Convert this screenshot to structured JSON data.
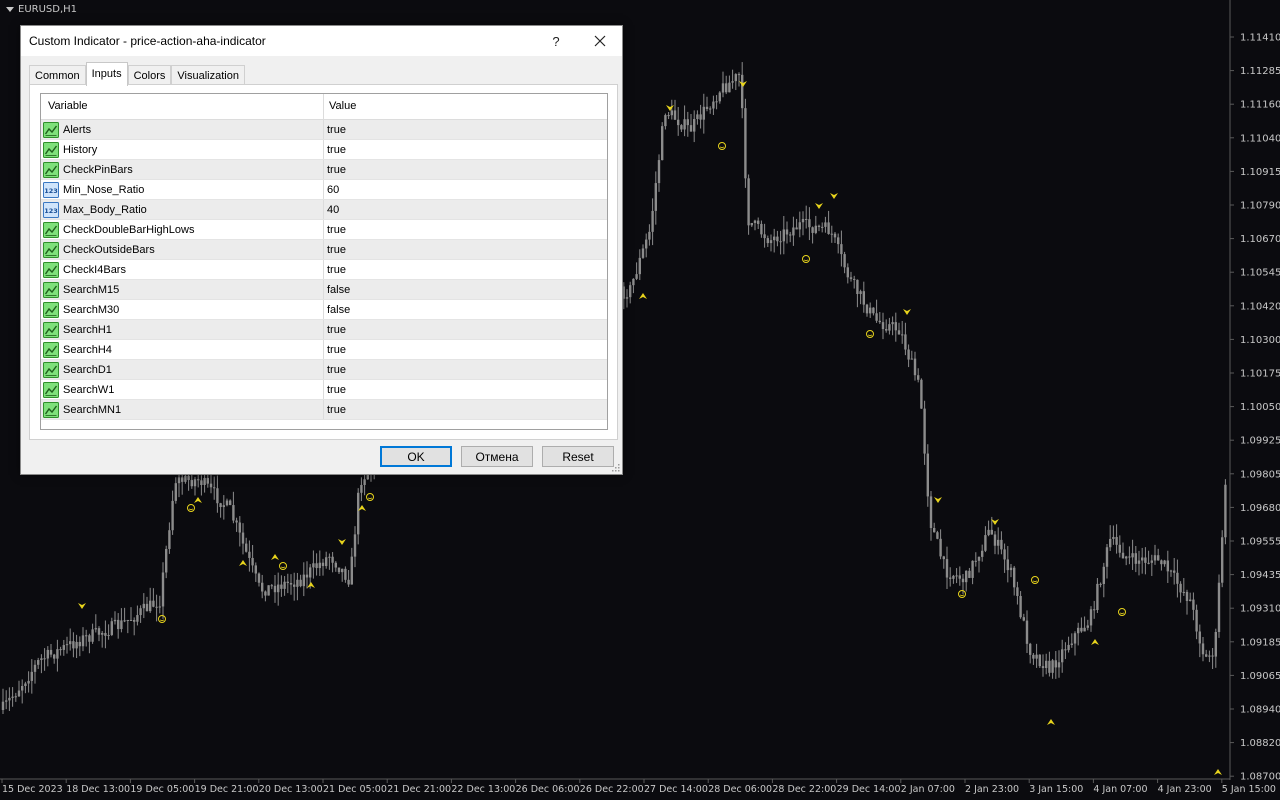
{
  "chart": {
    "symbol": "EURUSD,H1",
    "colors": {
      "background": "#0b0b0f",
      "candle": "#8c8c8c",
      "marker": "#e8d41c",
      "text": "#c8c8c8"
    },
    "price_labels": [
      "1.11410",
      "1.11285",
      "1.11160",
      "1.11040",
      "1.10915",
      "1.10790",
      "1.10670",
      "1.10545",
      "1.10420",
      "1.10300",
      "1.10175",
      "1.10050",
      "1.09925",
      "1.09805",
      "1.09680",
      "1.09555",
      "1.09435",
      "1.09310",
      "1.09185",
      "1.09065",
      "1.08940",
      "1.08820",
      "1.08700"
    ],
    "time_labels": [
      "15 Dec 2023",
      "18 Dec 13:00",
      "19 Dec 05:00",
      "19 Dec 21:00",
      "20 Dec 13:00",
      "21 Dec 05:00",
      "21 Dec 21:00",
      "22 Dec 13:00",
      "26 Dec 06:00",
      "26 Dec 22:00",
      "27 Dec 14:00",
      "28 Dec 06:00",
      "28 Dec 22:00",
      "29 Dec 14:00",
      "2 Jan 07:00",
      "2 Jan 23:00",
      "3 Jan 15:00",
      "4 Jan 07:00",
      "4 Jan 23:00",
      "5 Jan 15:00"
    ]
  },
  "dialog": {
    "title": "Custom Indicator - price-action-aha-indicator",
    "help_label": "?",
    "close_label": "✕",
    "tabs": [
      {
        "label": "Common"
      },
      {
        "label": "Inputs"
      },
      {
        "label": "Colors"
      },
      {
        "label": "Visualization"
      }
    ],
    "active_tab": "Inputs",
    "grid": {
      "col_variable": "Variable",
      "col_value": "Value",
      "rows": [
        {
          "icon": "bool-icon",
          "name": "Alerts",
          "value": "true"
        },
        {
          "icon": "bool-icon",
          "name": "History",
          "value": "true"
        },
        {
          "icon": "bool-icon",
          "name": "CheckPinBars",
          "value": "true"
        },
        {
          "icon": "number-icon",
          "name": "Min_Nose_Ratio",
          "value": "60"
        },
        {
          "icon": "number-icon",
          "name": "Max_Body_Ratio",
          "value": "40"
        },
        {
          "icon": "bool-icon",
          "name": "CheckDoubleBarHighLows",
          "value": "true"
        },
        {
          "icon": "bool-icon",
          "name": "CheckOutsideBars",
          "value": "true"
        },
        {
          "icon": "bool-icon",
          "name": "CheckI4Bars",
          "value": "true"
        },
        {
          "icon": "bool-icon",
          "name": "SearchM15",
          "value": "false"
        },
        {
          "icon": "bool-icon",
          "name": "SearchM30",
          "value": "false"
        },
        {
          "icon": "bool-icon",
          "name": "SearchH1",
          "value": "true"
        },
        {
          "icon": "bool-icon",
          "name": "SearchH4",
          "value": "true"
        },
        {
          "icon": "bool-icon",
          "name": "SearchD1",
          "value": "true"
        },
        {
          "icon": "bool-icon",
          "name": "SearchW1",
          "value": "true"
        },
        {
          "icon": "bool-icon",
          "name": "SearchMN1",
          "value": "true"
        }
      ]
    },
    "buttons": {
      "ok": "OK",
      "cancel": "Отмена",
      "reset": "Reset"
    }
  }
}
